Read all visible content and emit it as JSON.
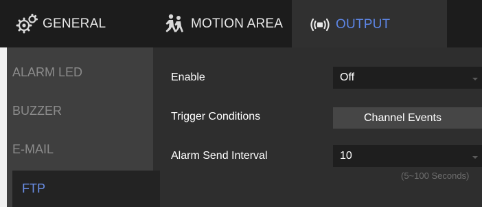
{
  "tabs": [
    {
      "label": "GENERAL",
      "icon": "gears-icon",
      "active": false
    },
    {
      "label": "MOTION AREA",
      "icon": "running-people-icon",
      "active": false
    },
    {
      "label": "OUTPUT",
      "icon": "signal-output-icon",
      "active": true
    }
  ],
  "sidebar": {
    "items": [
      {
        "label": "ALARM LED",
        "active": false
      },
      {
        "label": "BUZZER",
        "active": false
      },
      {
        "label": "E-MAIL",
        "active": false
      },
      {
        "label": "FTP",
        "active": true
      }
    ]
  },
  "form": {
    "enable": {
      "label": "Enable",
      "value": "Off"
    },
    "trigger": {
      "label": "Trigger Conditions",
      "button_label": "Channel Events"
    },
    "interval": {
      "label": "Alarm Send Interval",
      "value": "10",
      "hint": "(5~100 Seconds)"
    }
  },
  "colors": {
    "accent": "#5d86e6",
    "tab_bar_bg": "#1c1c1c",
    "panel_bg": "#2e2e2e",
    "sidebar_bg": "#3f3f3f",
    "outer_bg": "#f1f1f1"
  }
}
